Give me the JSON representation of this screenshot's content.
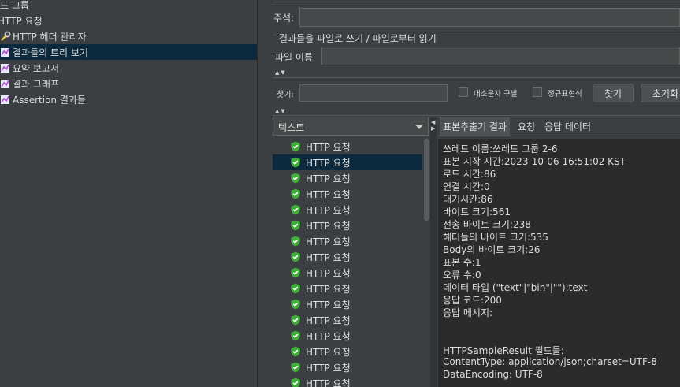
{
  "tree": {
    "items": [
      {
        "label": "드 그룹",
        "icon": "thread-group-icon"
      },
      {
        "label": "HTTP 요청",
        "icon": "none"
      },
      {
        "label": "HTTP 헤더 관리자",
        "icon": "wrench-icon"
      },
      {
        "label": "결과들의 트리 보기",
        "icon": "graph-icon"
      },
      {
        "label": "요약 보고서",
        "icon": "graph-icon"
      },
      {
        "label": "결과 그래프",
        "icon": "graph-icon"
      },
      {
        "label": "Assertion 결과들",
        "icon": "graph-icon"
      }
    ]
  },
  "comment": {
    "label": "주석:",
    "value": ""
  },
  "file_section": {
    "legend": "결과들을 파일로 쓰기 / 파일로부터 읽기",
    "file_label": "파일 이름",
    "file_value": ""
  },
  "search": {
    "label": "찾기:",
    "value": "",
    "case_label": "대소문자 구별",
    "regex_label": "정규표현식",
    "find_button": "찾기",
    "reset_button": "초기화"
  },
  "renderer": {
    "selected": "텍스트"
  },
  "results": {
    "items": [
      "HTTP 요청",
      "HTTP 요청",
      "HTTP 요청",
      "HTTP 요청",
      "HTTP 요청",
      "HTTP 요청",
      "HTTP 요청",
      "HTTP 요청",
      "HTTP 요청",
      "HTTP 요청",
      "HTTP 요청",
      "HTTP 요청",
      "HTTP 요청",
      "HTTP 요청",
      "HTTP 요청",
      "HTTP 요청"
    ],
    "selected_index": 1
  },
  "tabs": [
    "표본추출기 결과",
    "요청",
    "응답 데이터"
  ],
  "detail": {
    "lines": [
      "쓰레드 이름:쓰레드 그룹 2-6",
      "표본 시작 시간:2023-10-06 16:51:02 KST",
      "로드 시간:86",
      "연결 시간:0",
      "대기시간:86",
      "바이트 크기:561",
      "전송 바이트 크기:238",
      "헤더들의 바이트 크기:535",
      "Body의 바이트 크기:26",
      "표본 수:1",
      "오류 수:0",
      "데이터 타입 (\"text\"|\"bin\"|\"\"):text",
      "응답 코드:200",
      "응답 메시지:",
      "",
      "",
      "HTTPSampleResult 필드들:",
      "ContentType: application/json;charset=UTF-8",
      "DataEncoding: UTF-8"
    ]
  },
  "colors": {
    "background": "#3c3f41",
    "selection": "#0d293e",
    "success": "#3fae3b",
    "text": "#dcdcdc"
  }
}
